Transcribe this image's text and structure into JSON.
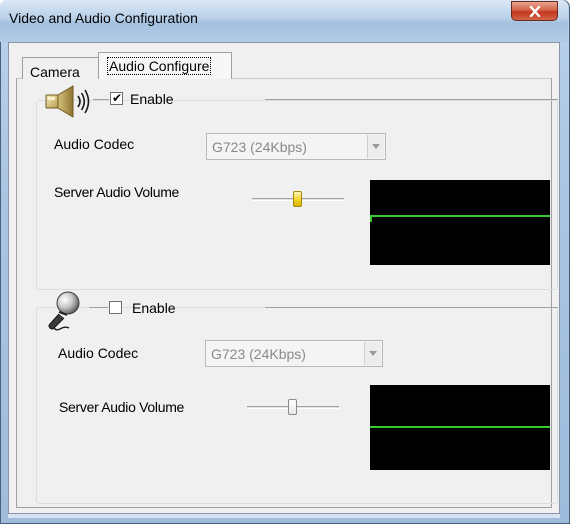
{
  "window": {
    "title": "Video and Audio Configuration",
    "close_label": "x"
  },
  "tabs": [
    {
      "label": "Camera",
      "active": false
    },
    {
      "label": "Audio Configure",
      "active": true
    }
  ],
  "speaker_group": {
    "icon": "speaker-icon",
    "enable_label": "Enable",
    "enabled": true,
    "codec_label": "Audio Codec",
    "codec_value": "G723 (24Kbps)",
    "volume_label": "Server Audio Volume",
    "volume_level_percent": 50
  },
  "microphone_group": {
    "icon": "microphone-icon",
    "enable_label": "Enable",
    "enabled": false,
    "codec_label": "Audio Codec",
    "codec_value": "G723 (24Kbps)",
    "volume_label": "Server Audio Volume",
    "volume_level_percent": 50
  },
  "colors": {
    "meter_background": "#000000",
    "meter_signal": "#37c92e",
    "active_slider_thumb": "#f2d21c"
  }
}
